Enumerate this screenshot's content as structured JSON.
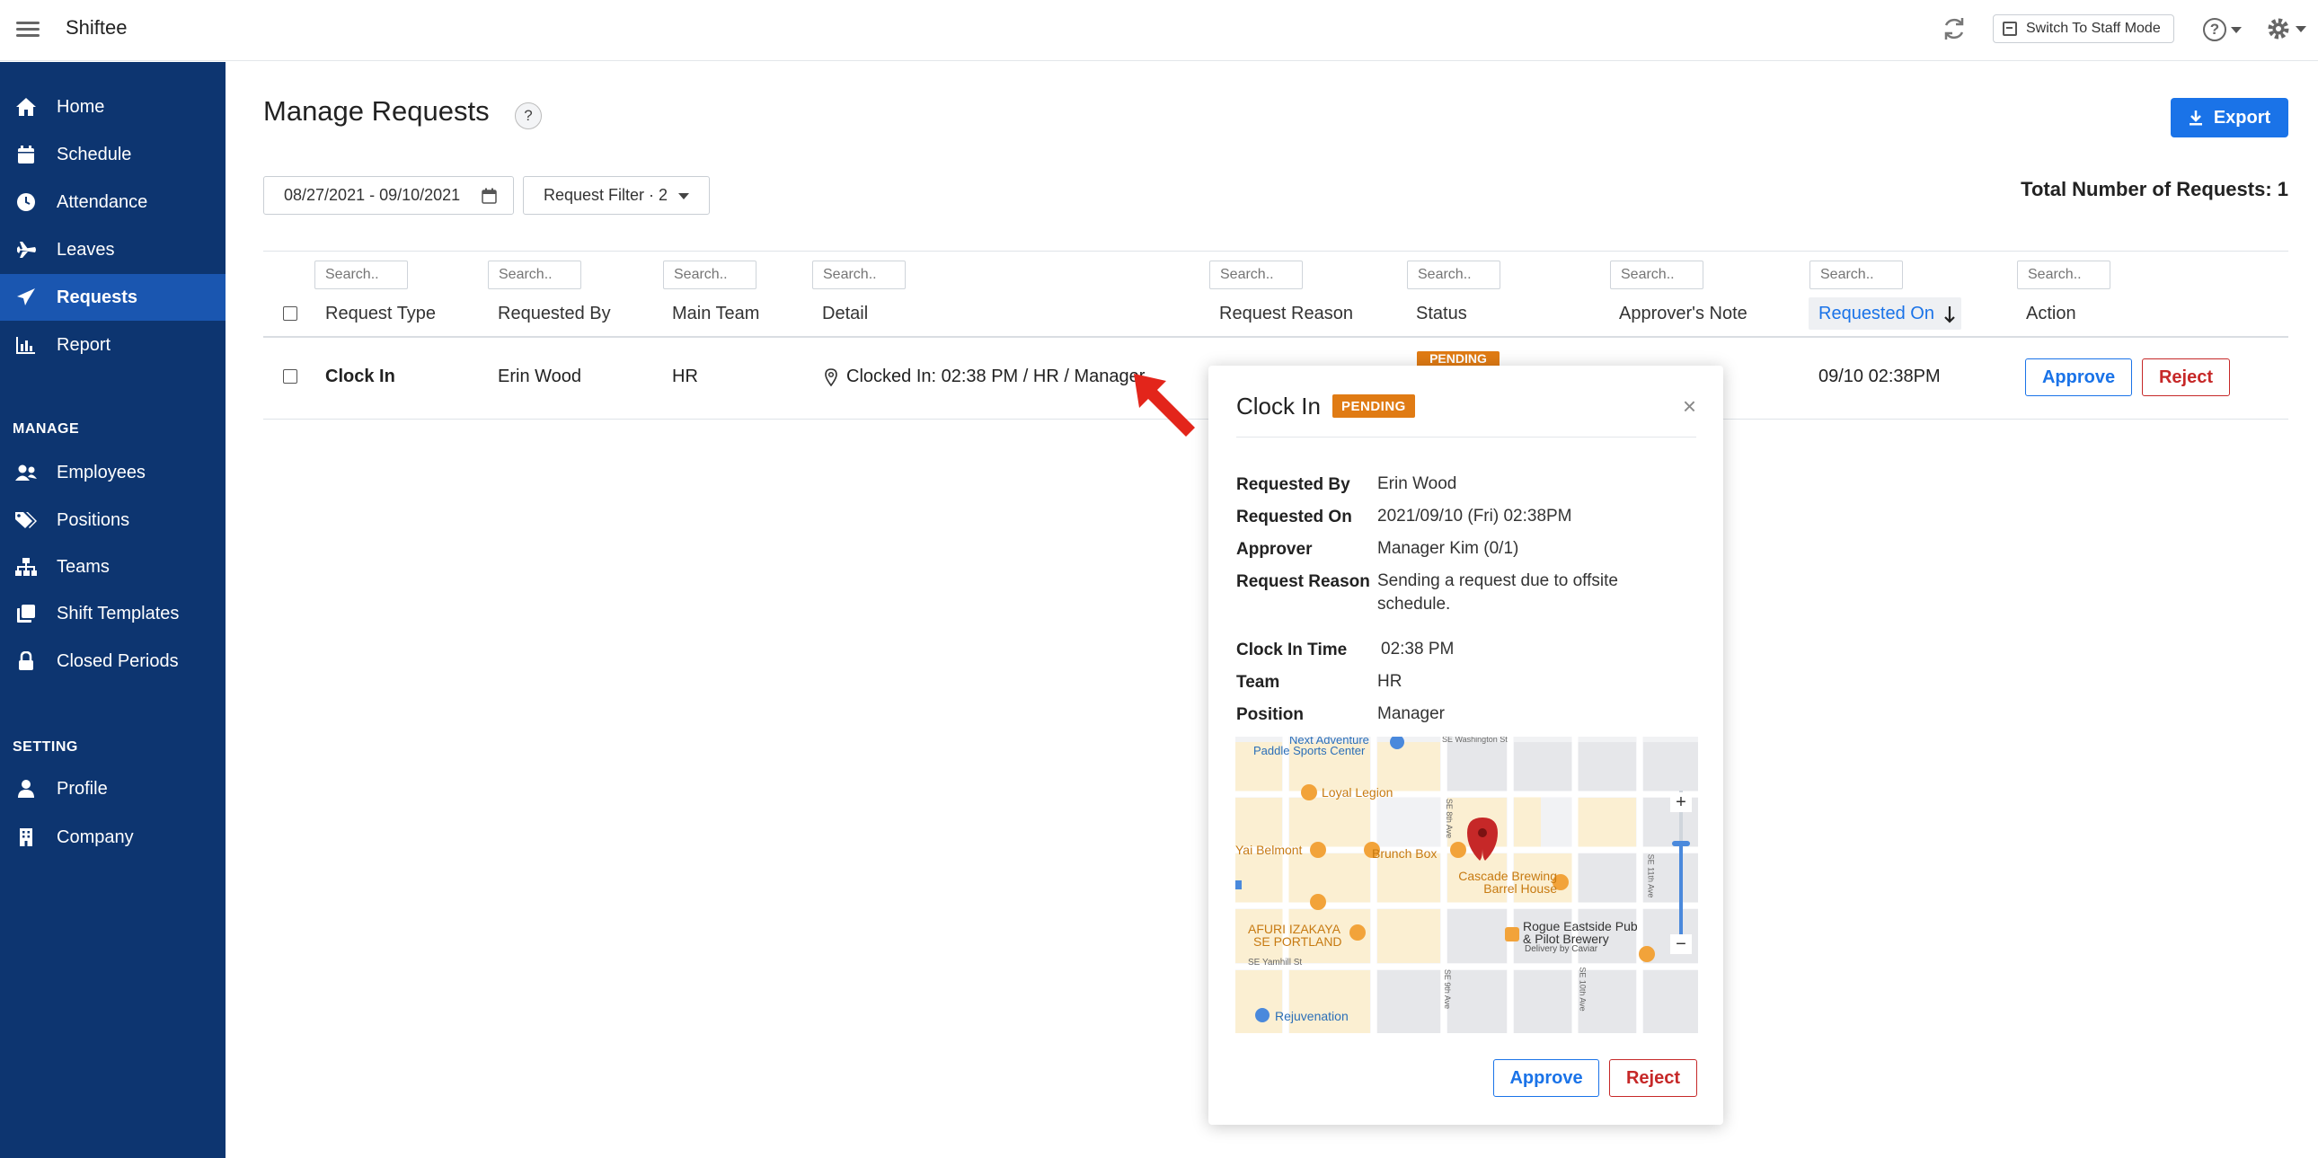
{
  "app": {
    "title": "Shiftee"
  },
  "topbar": {
    "staff_mode_label": "Switch To Staff Mode"
  },
  "sidebar": {
    "items": [
      {
        "label": "Home",
        "icon": "home-icon"
      },
      {
        "label": "Schedule",
        "icon": "calendar-icon"
      },
      {
        "label": "Attendance",
        "icon": "clock-icon"
      },
      {
        "label": "Leaves",
        "icon": "plane-icon"
      },
      {
        "label": "Requests",
        "icon": "paper-plane-icon",
        "active": true
      },
      {
        "label": "Report",
        "icon": "bar-chart-icon"
      }
    ],
    "manage_label": "MANAGE",
    "manage_items": [
      {
        "label": "Employees",
        "icon": "users-icon"
      },
      {
        "label": "Positions",
        "icon": "tags-icon"
      },
      {
        "label": "Teams",
        "icon": "org-chart-icon"
      },
      {
        "label": "Shift Templates",
        "icon": "copy-icon"
      },
      {
        "label": "Closed Periods",
        "icon": "lock-icon"
      }
    ],
    "setting_label": "SETTING",
    "setting_items": [
      {
        "label": "Profile",
        "icon": "user-icon"
      },
      {
        "label": "Company",
        "icon": "building-icon"
      }
    ]
  },
  "main": {
    "title": "Manage Requests",
    "help": "?",
    "export_label": "Export",
    "date_range": "08/27/2021 - 09/10/2021",
    "filter_label": "Request Filter · 2",
    "total_label": "Total Number of Requests: 1",
    "search_placeholder": "Search..",
    "columns": [
      "Request Type",
      "Requested By",
      "Main Team",
      "Detail",
      "Request Reason",
      "Status",
      "Approver's Note",
      "Requested On",
      "Action"
    ],
    "rows": [
      {
        "request_type": "Clock In",
        "requested_by": "Erin Wood",
        "main_team": "HR",
        "detail": "Clocked In: 02:38 PM / HR / Manager",
        "status": "PENDING",
        "requested_on": "09/10 02:38PM",
        "approve_label": "Approve",
        "reject_label": "Reject"
      }
    ]
  },
  "popover": {
    "title": "Clock In",
    "badge": "PENDING",
    "close": "×",
    "fields": [
      {
        "key": "Requested By",
        "value": "Erin Wood"
      },
      {
        "key": "Requested On",
        "value": "2021/09/10 (Fri) 02:38PM"
      },
      {
        "key": "Approver",
        "value": "Manager Kim (0/1)"
      },
      {
        "key": "Request Reason",
        "value": "Sending a request due to offsite",
        "value2": "schedule."
      },
      {
        "key": "Clock In Time",
        "value": "02:38 PM"
      },
      {
        "key": "Team",
        "value": "HR"
      },
      {
        "key": "Position",
        "value": "Manager"
      }
    ],
    "map": {
      "labels": {
        "next_adventure_1": "Next Adventure",
        "next_adventure_2": "Paddle Sports Center",
        "loyal_legion": "Loyal Legion",
        "yai_belmont": "Yai Belmont",
        "brunch_box": "Brunch Box",
        "cascade_1": "Cascade Brewing",
        "cascade_2": "Barrel House",
        "afuri_1": "AFURI IZAKAYA",
        "afuri_2": "SE PORTLAND",
        "rogue_1": "Rogue Eastside Pub",
        "rogue_2": "& Pilot Brewery",
        "rogue_3": "Delivery by Caviar",
        "rejuvenation": "Rejuvenation",
        "se_washington": "SE Washington St",
        "se_yamhill": "SE Yamhill St",
        "se_8th": "SE 8th Ave",
        "se_11th": "SE 11th Ave",
        "se_9th": "SE 9th Ave",
        "se_10th": "SE 10th Ave"
      },
      "zoom_in": "+",
      "zoom_out": "−"
    },
    "approve_label": "Approve",
    "reject_label": "Reject"
  },
  "colors": {
    "sidebar": "#0d3570",
    "active": "#1a56b0",
    "primary": "#1a73e8",
    "danger": "#c62828",
    "pending": "#e07b14"
  }
}
